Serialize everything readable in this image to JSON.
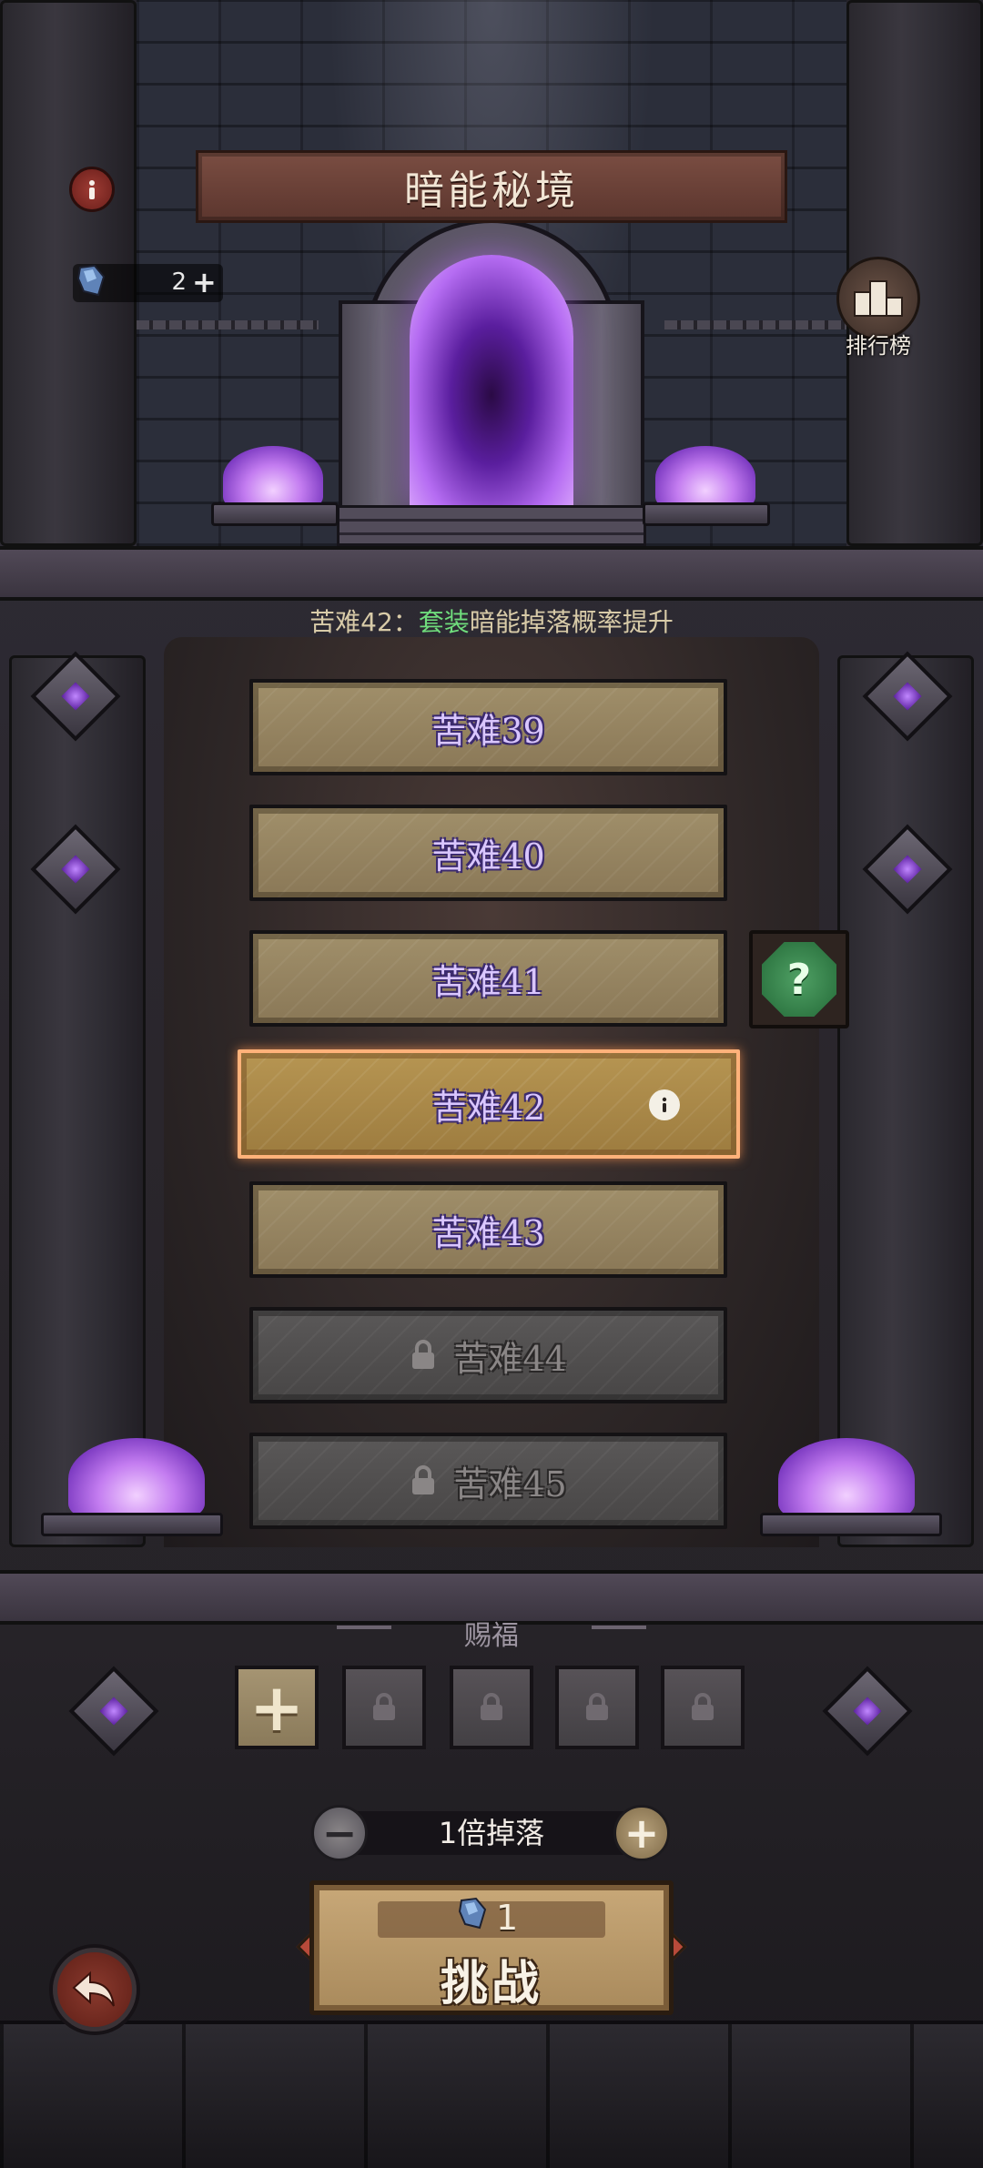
{
  "header": {
    "title": "暗能秘境",
    "info_icon": "info-icon",
    "resource": {
      "icon": "shard-icon",
      "count": "2",
      "plus": "+"
    },
    "leaderboard": {
      "icon": "leaderboard-icon",
      "label": "排行榜"
    }
  },
  "notice": {
    "prefix": "苦难42：",
    "highlight": "套装",
    "suffix": "暗能掉落概率提升",
    "highlight_color": "#6fdc7c"
  },
  "levels": [
    {
      "label": "苦难39",
      "state": "unlocked"
    },
    {
      "label": "苦难40",
      "state": "unlocked"
    },
    {
      "label": "苦难41",
      "state": "unlocked"
    },
    {
      "label": "苦难42",
      "state": "selected"
    },
    {
      "label": "苦难43",
      "state": "unlocked"
    },
    {
      "label": "苦难44",
      "state": "locked"
    },
    {
      "label": "苦难45",
      "state": "locked"
    }
  ],
  "hint_button": {
    "icon": "question-gem-icon",
    "glyph": "?"
  },
  "blessing": {
    "title": "赐福",
    "slots": [
      {
        "state": "add",
        "glyph": "+"
      },
      {
        "state": "locked"
      },
      {
        "state": "locked"
      },
      {
        "state": "locked"
      },
      {
        "state": "locked"
      }
    ]
  },
  "multiplier": {
    "label": "1倍掉落",
    "minus": "−",
    "plus": "+"
  },
  "challenge": {
    "cost_icon": "shard-icon",
    "cost": "1",
    "label": "挑战"
  },
  "back_button": {
    "icon": "back-arrow-icon"
  },
  "colors": {
    "level_text": "#d9c6ff",
    "selected_border": "#ffb27a",
    "portal_glow": "#b56cf2"
  }
}
